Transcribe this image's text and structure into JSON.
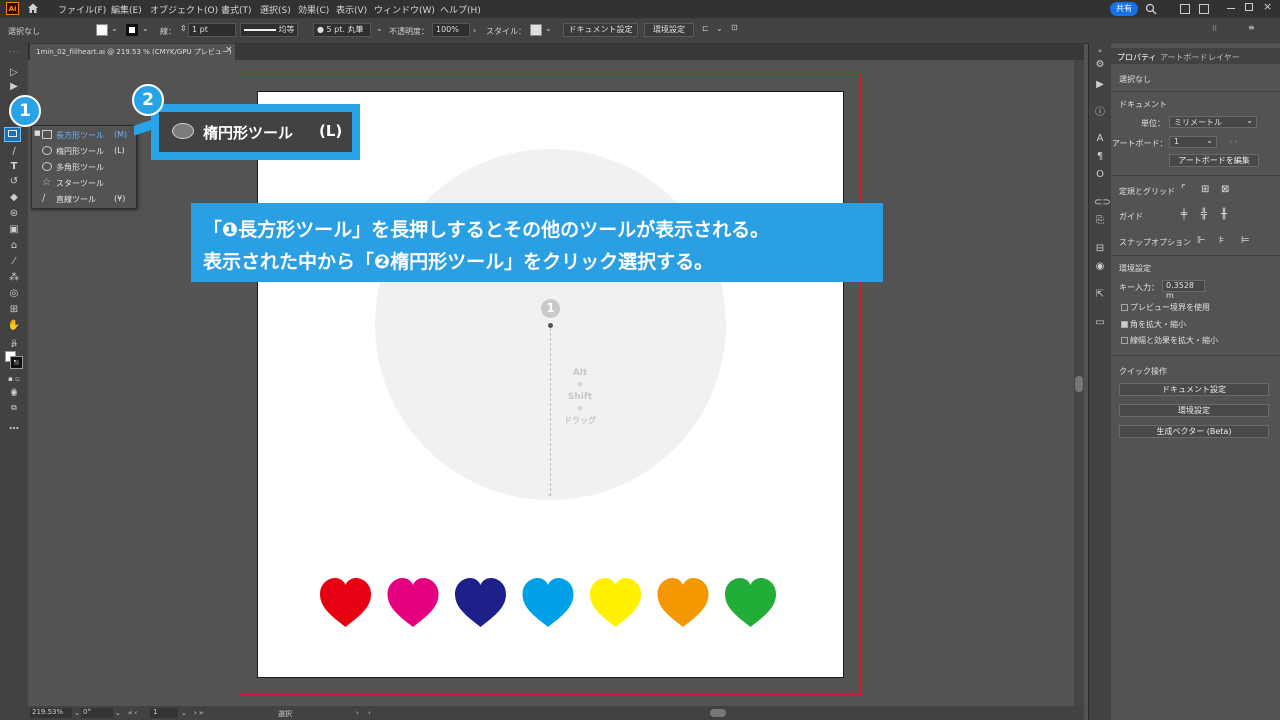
{
  "menu": {
    "app_logo": "Ai",
    "items": [
      "ファイル(F)",
      "編集(E)",
      "オブジェクト(O)",
      "書式(T)",
      "選択(S)",
      "効果(C)",
      "表示(V)",
      "ウィンドウ(W)",
      "ヘルプ(H)"
    ],
    "share_label": "共有"
  },
  "control_bar": {
    "selection_label": "選択なし",
    "stroke_label": "線：",
    "stroke_weight": "1 pt",
    "stroke_profile": "均等",
    "brush_label": "5 pt. 丸筆",
    "opacity_label": "不透明度：",
    "opacity_value": "100%",
    "style_label": "スタイル：",
    "doc_setup_button": "ドキュメント設定",
    "preferences_button": "環境設定"
  },
  "document_tab": {
    "title": "1min_02_fillheart.ai @ 219.53 % (CMYK/GPU プレビュー)",
    "close": "×"
  },
  "flyout": {
    "items": [
      {
        "label": "長方形ツール",
        "key": "(M)"
      },
      {
        "label": "楕円形ツール",
        "key": "(L)"
      },
      {
        "label": "多角形ツール",
        "key": ""
      },
      {
        "label": "スターツール",
        "key": ""
      },
      {
        "label": "直線ツール",
        "key": "(¥)"
      }
    ]
  },
  "callout": {
    "badge1": "1",
    "badge2": "2",
    "tool_label": "楕円形ツール",
    "tool_key": "(L)"
  },
  "banner": {
    "line1": "「❶長方形ツール」を長押しするとその他のツールが表示される。",
    "line2": "表示された中から「❷楕円形ツール」をクリック選択する。"
  },
  "artboard": {
    "step_number": "1",
    "drag_hint": [
      "Alt",
      "+",
      "Shift",
      "+",
      "ドラッグ"
    ],
    "heart_colors": [
      "#e60012",
      "#e4007f",
      "#1d2088",
      "#00a0e9",
      "#fff100",
      "#f39800",
      "#22ac38"
    ]
  },
  "properties_panel": {
    "tabs": [
      "プロパティ",
      "アートボード",
      "レイヤー"
    ],
    "no_selection": "選択なし",
    "document_header": "ドキュメント",
    "unit_label": "単位：",
    "unit_value": "ミリメートル",
    "artboard_label": "アートボード：",
    "artboard_value": "1",
    "edit_artboard_button": "アートボードを編集",
    "rulers_grid_label": "定規とグリッド",
    "guides_label": "ガイド",
    "snap_label": "スナップオプション",
    "preferences_header": "環境設定",
    "key_input_label": "キー入力：",
    "key_input_value": "0.3528 m",
    "preview_bounds": "プレビュー境界を使用",
    "scale_corners": "角を拡大・縮小",
    "scale_strokes": "線幅と効果を拡大・縮小",
    "quick_actions_header": "クイック操作",
    "qa_doc_setup": "ドキュメント設定",
    "qa_preferences": "環境設定",
    "qa_generative": "生成ベクター (Beta)"
  },
  "status_bar": {
    "zoom": "219.53%",
    "rotation": "0°",
    "artboard_num": "1",
    "mode": "選択"
  }
}
